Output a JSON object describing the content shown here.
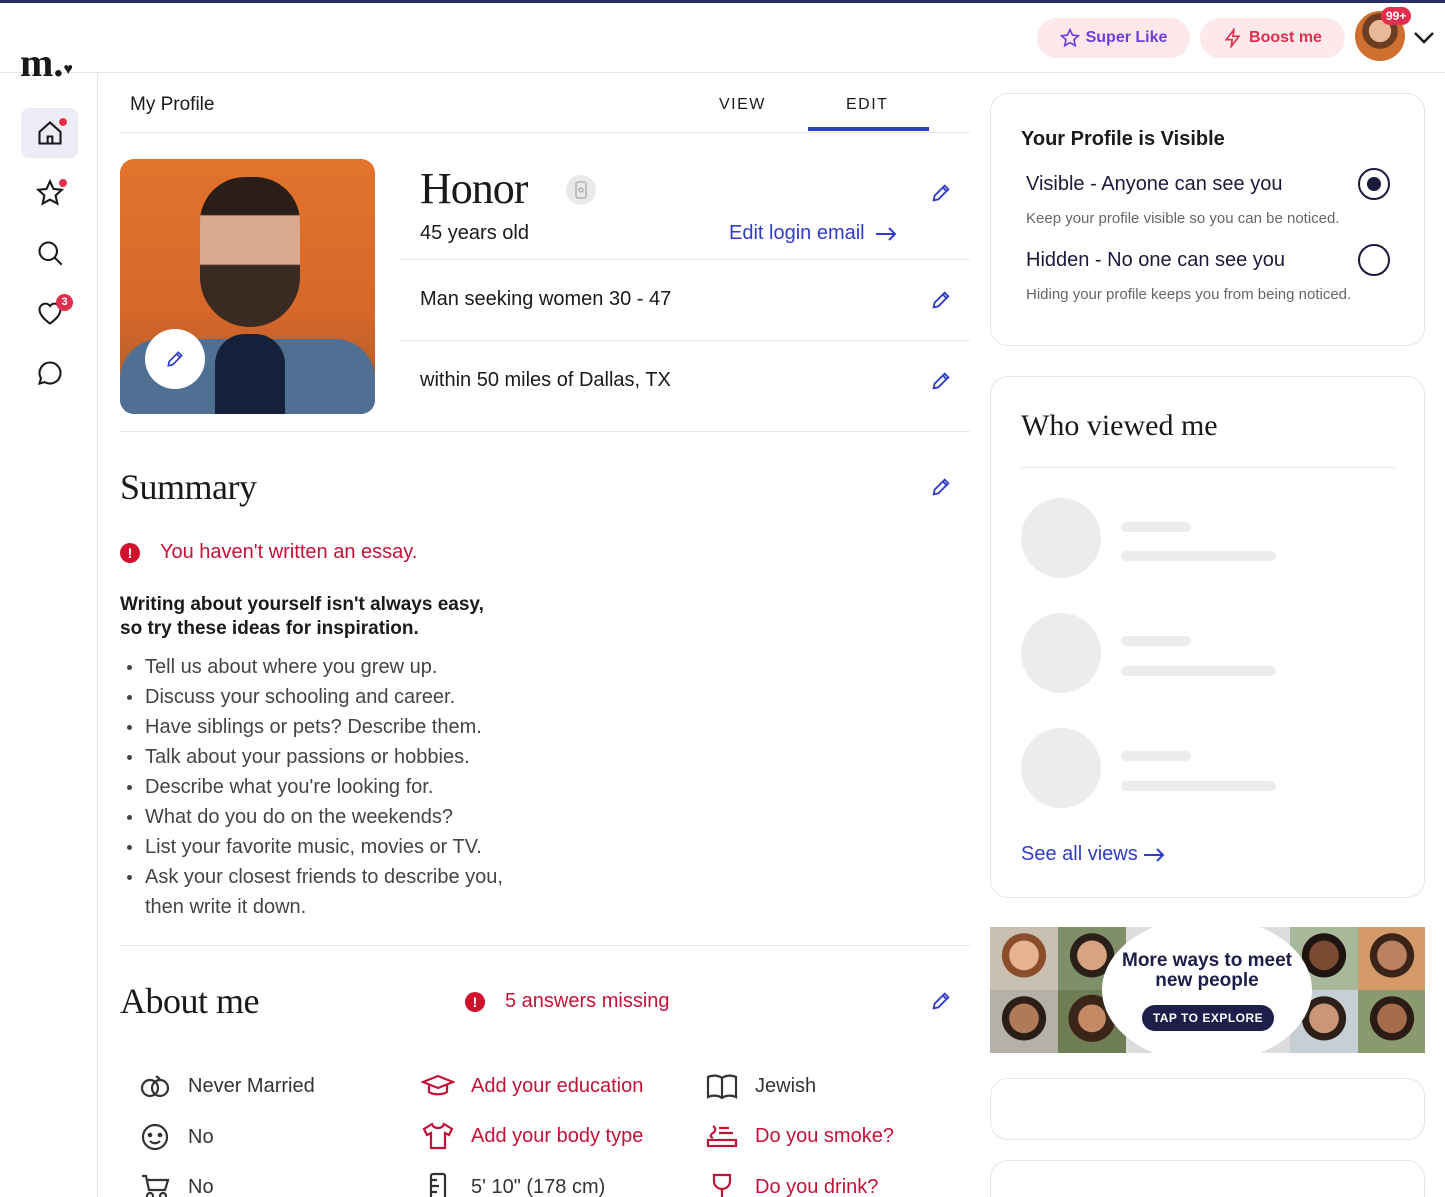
{
  "header": {
    "logo": "m.",
    "super_like": "Super Like",
    "boost": "Boost me",
    "avatar_badge": "99+"
  },
  "sidebar": {
    "items": [
      {
        "name": "home",
        "active": true,
        "dot": true
      },
      {
        "name": "favorites",
        "dot": true
      },
      {
        "name": "search"
      },
      {
        "name": "likes",
        "count": "3"
      },
      {
        "name": "messages"
      }
    ]
  },
  "tabs": {
    "title": "My Profile",
    "view": "VIEW",
    "edit": "EDIT",
    "active": "EDIT"
  },
  "profile": {
    "name": "Honor",
    "age": "45 years old",
    "edit_login_email": "Edit login email",
    "seeking": "Man seeking women 30 - 47",
    "location": "within 50 miles of Dallas, TX"
  },
  "summary": {
    "heading": "Summary",
    "warning": "You haven't written an essay.",
    "inspiration_line1": "Writing about yourself isn't always easy,",
    "inspiration_line2": "so try these ideas for inspiration.",
    "ideas": [
      "Tell us about where you grew up.",
      "Discuss your schooling and career.",
      "Have siblings or pets? Describe them.",
      "Talk about your passions or hobbies.",
      "Describe what you're looking for.",
      "What do you do on the weekends?",
      "List your favorite music, movies or TV.",
      "Ask your closest friends to describe you, then write it down."
    ]
  },
  "about": {
    "heading": "About me",
    "missing": "5 answers missing",
    "attributes": [
      {
        "icon": "rings-icon",
        "label": "Never Married",
        "missing": false
      },
      {
        "icon": "graduation-cap-icon",
        "label": "Add your education",
        "missing": true
      },
      {
        "icon": "book-icon",
        "label": "Jewish",
        "missing": false
      },
      {
        "icon": "baby-face-icon",
        "label": "No",
        "missing": false
      },
      {
        "icon": "shirt-icon",
        "label": "Add your body type",
        "missing": true
      },
      {
        "icon": "smoke-icon",
        "label": "Do you smoke?",
        "missing": true
      },
      {
        "icon": "stroller-icon",
        "label": "No",
        "missing": false
      },
      {
        "icon": "ruler-icon",
        "label": "5' 10\" (178 cm)",
        "missing": false
      },
      {
        "icon": "wine-glass-icon",
        "label": "Do you drink?",
        "missing": true
      }
    ]
  },
  "visibility": {
    "title": "Your Profile is Visible",
    "visible_label": "Visible - Anyone can see you",
    "visible_help": "Keep your profile visible so you can be noticed.",
    "hidden_label": "Hidden - No one can see you",
    "hidden_help": "Hiding your profile keeps you from being noticed.",
    "selected": "visible"
  },
  "who_viewed": {
    "title": "Who viewed me",
    "see_all": "See all views"
  },
  "promo": {
    "headline": "More ways to meet new people",
    "cta": "TAP TO EXPLORE"
  },
  "colors": {
    "accent_blue": "#2f3cc9",
    "alert_red": "#c41236",
    "boost_pink": "#e0304e",
    "super_purple": "#6b3fd9"
  }
}
